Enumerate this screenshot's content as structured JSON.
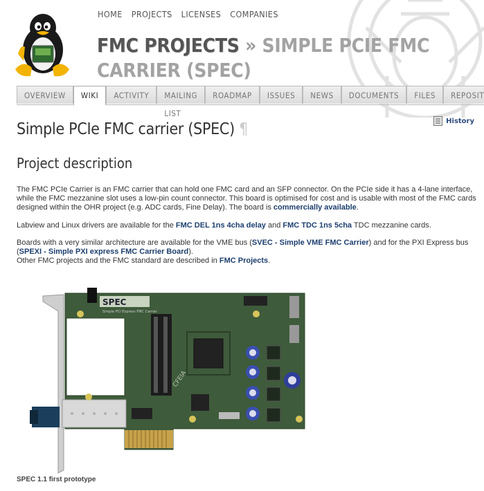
{
  "topnav": [
    "HOME",
    "PROJECTS",
    "LICENSES",
    "COMPANIES"
  ],
  "title": {
    "parent": "FMC PROJECTS",
    "separator": "»",
    "current": "SIMPLE PCIE FMC CARRIER (SPEC)"
  },
  "tabs": [
    {
      "label": "OVERVIEW",
      "selected": false
    },
    {
      "label": "WIKI",
      "selected": true
    },
    {
      "label": "ACTIVITY",
      "selected": false
    },
    {
      "label": "MAILING LIST",
      "selected": false
    },
    {
      "label": "ROADMAP",
      "selected": false
    },
    {
      "label": "ISSUES",
      "selected": false
    },
    {
      "label": "NEWS",
      "selected": false
    },
    {
      "label": "DOCUMENTS",
      "selected": false
    },
    {
      "label": "FILES",
      "selected": false
    },
    {
      "label": "REPOSITORY",
      "selected": false
    }
  ],
  "history_label": "History",
  "page_title": "Simple PCIe FMC carrier (SPEC)",
  "pilcrow": "¶",
  "section_title": "Project description",
  "para1": {
    "text": "The FMC PCIe Carrier is an FMC carrier that can hold one FMC card and an SFP connector. On the PCIe side it has a 4-lane interface, while the FMC mezzanine slot uses a low-pin count connector. This board is optimised for cost and is usable with most of the FMC cards designed within the OHR project (e.g. ADC cards, Fine Delay). The board is ",
    "link": "commercially available",
    "end": "."
  },
  "para2": {
    "t1": "Labview and Linux drivers are available for the ",
    "link1": "FMC DEL 1ns 4cha delay",
    "t2": " and ",
    "link2": "FMC TDC 1ns 5cha",
    "t3": " TDC mezzanine cards."
  },
  "para3": {
    "t1": "Boards with a very similar architecture are available for the VME bus (",
    "link1": "SVEC - Simple VME FMC Carrier",
    "t2": ") and for the PXI Express bus (",
    "link2": "SPEXI - Simple PXI express FMC Carrier Board",
    "t3": ")."
  },
  "para4": {
    "t1": "Other FMC projects and the FMC standard are described in ",
    "link": "FMC Projects",
    "t2": "."
  },
  "board_label": "SPEC",
  "board_sublabel": "Simple PCI Express FMC Carrier",
  "board_logo": "CFEIA",
  "caption": "SPEC 1.1 first prototype",
  "colors": {
    "link": "#1d3f6e",
    "board": "#3f5a3f",
    "tab_bg": "#e6e6e6"
  }
}
